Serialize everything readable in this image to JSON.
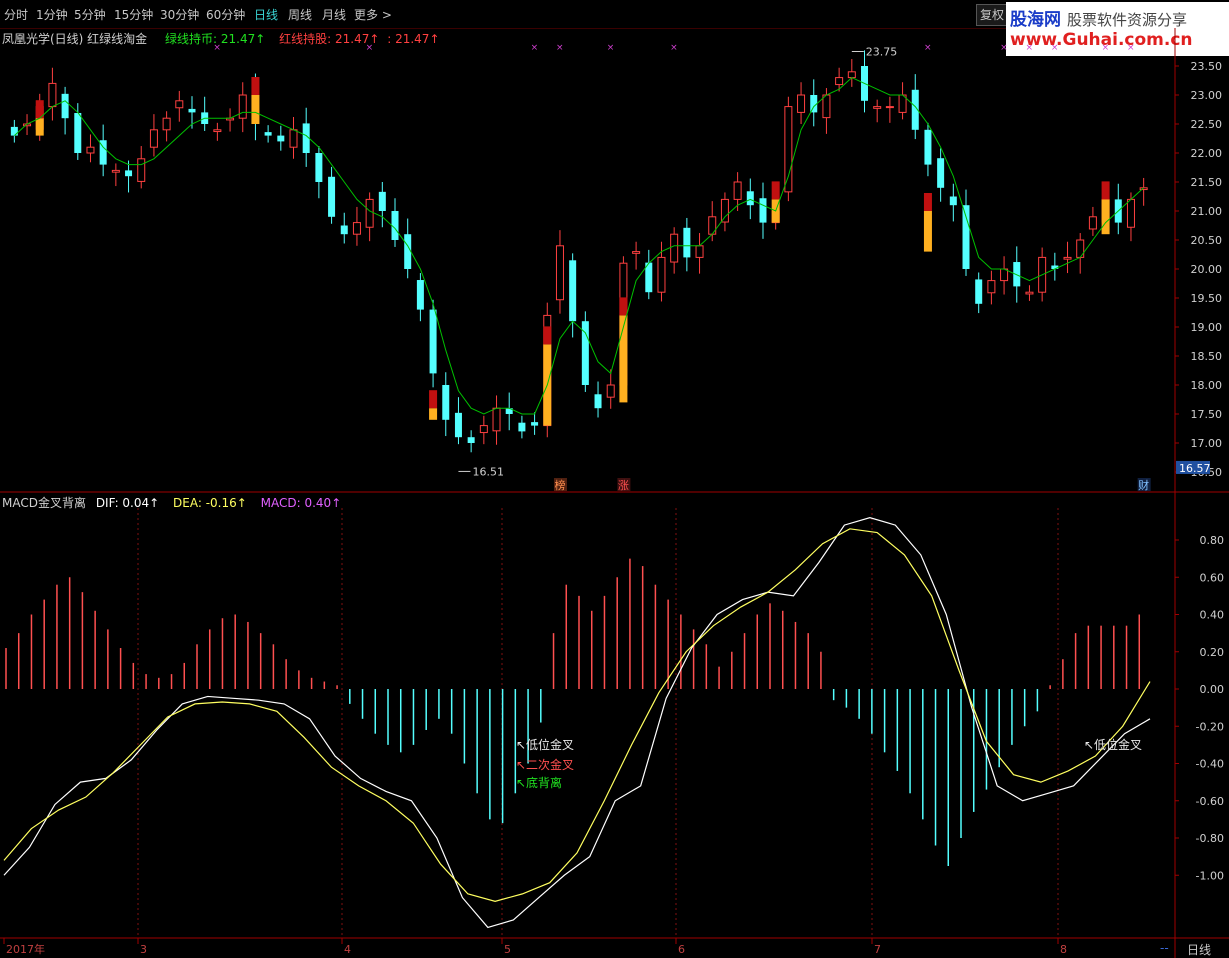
{
  "toolbar": {
    "periods": [
      "分时",
      "1分钟",
      "5分钟",
      "15分钟",
      "30分钟",
      "60分钟",
      "日线",
      "周线",
      "月线",
      "更多 >"
    ],
    "active": "日线",
    "fuquan": "复权"
  },
  "logo": {
    "line1": "股海网",
    "line1b": "股票软件资源分享",
    "line2": "www.Guhai.com.cn"
  },
  "main_panel": {
    "title": "凤凰光学(日线) 红绿线淘金",
    "green_label": "绿线持币: 21.47↑",
    "red_label": "红线持股: 21.47↑",
    "red_extra": ": 21.47↑",
    "high_label": "23.75",
    "low_label": "16.51",
    "last_price": "16.57",
    "markers": [
      "榜",
      "涨",
      "财"
    ]
  },
  "macd_panel": {
    "title": "MACD金叉背离",
    "dif": "DIF: 0.04↑",
    "dea": "DEA: -0.16↑",
    "macd": "MACD: 0.40↑",
    "annotations": [
      "↖低位金叉",
      "↖二次金叉",
      "↖底背离",
      "↖低位金叉"
    ]
  },
  "axis": {
    "dates": [
      "2017年",
      "3",
      "4",
      "5",
      "6",
      "7",
      "8"
    ],
    "footer_label": "日线",
    "footer_dash": "--"
  },
  "colors": {
    "up": "#ff4040",
    "down": "#54ffff",
    "green_line": "#00c000",
    "dif": "#ffffff",
    "dea": "#ffff60",
    "hist_up": "#ff5050",
    "hist_down": "#54ffff"
  },
  "chart_data": [
    {
      "type": "candlestick",
      "title": "凤凰光学(日线)",
      "ylim": [
        16.5,
        23.5
      ],
      "yticks": [
        16.5,
        17.0,
        17.5,
        18.0,
        18.5,
        19.0,
        19.5,
        20.0,
        20.5,
        21.0,
        21.5,
        22.0,
        22.5,
        23.0,
        23.5
      ],
      "close": [
        22.3,
        22.5,
        22.8,
        23.2,
        22.6,
        22.0,
        22.1,
        21.8,
        21.7,
        21.6,
        21.9,
        22.4,
        22.6,
        22.9,
        22.7,
        22.5,
        22.4,
        22.6,
        23.0,
        22.5,
        22.3,
        22.2,
        22.4,
        22.0,
        21.5,
        20.9,
        20.6,
        20.8,
        21.2,
        21.0,
        20.5,
        20.0,
        19.3,
        18.2,
        17.4,
        17.1,
        17.0,
        17.3,
        17.6,
        17.5,
        17.2,
        17.3,
        19.2,
        20.4,
        19.1,
        18.0,
        17.6,
        18.0,
        20.1,
        20.3,
        19.6,
        20.2,
        20.6,
        20.2,
        20.4,
        20.9,
        21.2,
        21.5,
        21.1,
        20.8,
        21.0,
        22.8,
        23.0,
        22.7,
        23.0,
        23.3,
        23.4,
        22.9,
        22.8,
        22.8,
        23.0,
        22.4,
        21.8,
        21.4,
        21.1,
        20.0,
        19.4,
        19.8,
        20.0,
        19.7,
        19.6,
        20.2,
        20.0,
        20.2,
        20.5,
        20.9,
        21.2,
        20.8,
        21.2,
        21.4
      ],
      "ma_line": [
        22.3,
        22.5,
        22.6,
        22.8,
        22.9,
        22.7,
        22.4,
        22.1,
        21.9,
        21.8,
        21.8,
        21.9,
        22.1,
        22.3,
        22.5,
        22.6,
        22.6,
        22.6,
        22.7,
        22.7,
        22.6,
        22.5,
        22.4,
        22.3,
        22.1,
        21.8,
        21.5,
        21.2,
        21.0,
        20.9,
        20.7,
        20.4,
        20.0,
        19.4,
        18.6,
        17.9,
        17.6,
        17.5,
        17.6,
        17.6,
        17.5,
        17.5,
        18.0,
        18.8,
        19.1,
        18.9,
        18.4,
        18.2,
        19.0,
        19.8,
        20.1,
        20.3,
        20.4,
        20.4,
        20.4,
        20.6,
        20.9,
        21.1,
        21.2,
        21.1,
        21.0,
        21.6,
        22.4,
        22.8,
        23.0,
        23.1,
        23.3,
        23.2,
        23.1,
        23.0,
        23.0,
        22.8,
        22.5,
        22.1,
        21.6,
        20.9,
        20.2,
        20.0,
        20.0,
        19.9,
        19.8,
        19.9,
        20.0,
        20.1,
        20.2,
        20.5,
        20.8,
        21.0,
        21.2,
        21.4
      ]
    },
    {
      "type": "bar",
      "title": "MACD金叉背离",
      "ylim": [
        -1.1,
        1.0
      ],
      "yticks": [
        0.8,
        0.6,
        0.4,
        0.2,
        -0.0,
        -0.2,
        -0.4,
        -0.6,
        -0.8,
        -1.0
      ],
      "histogram": [
        0.22,
        0.3,
        0.4,
        0.48,
        0.56,
        0.6,
        0.52,
        0.42,
        0.32,
        0.22,
        0.14,
        0.08,
        0.06,
        0.08,
        0.14,
        0.24,
        0.32,
        0.38,
        0.4,
        0.36,
        0.3,
        0.24,
        0.16,
        0.1,
        0.06,
        0.04,
        0.02,
        -0.08,
        -0.16,
        -0.24,
        -0.3,
        -0.34,
        -0.3,
        -0.22,
        -0.16,
        -0.24,
        -0.4,
        -0.56,
        -0.7,
        -0.72,
        -0.56,
        -0.4,
        -0.18,
        0.3,
        0.56,
        0.5,
        0.42,
        0.5,
        0.6,
        0.7,
        0.66,
        0.56,
        0.48,
        0.4,
        0.32,
        0.24,
        0.12,
        0.2,
        0.3,
        0.4,
        0.46,
        0.42,
        0.36,
        0.3,
        0.2,
        -0.06,
        -0.1,
        -0.16,
        -0.24,
        -0.34,
        -0.44,
        -0.56,
        -0.7,
        -0.84,
        -0.95,
        -0.8,
        -0.66,
        -0.54,
        -0.42,
        -0.3,
        -0.2,
        -0.12,
        0.02,
        0.16,
        0.3,
        0.34,
        0.34,
        0.34,
        0.34,
        0.4
      ],
      "dif": [
        -1.0,
        -0.85,
        -0.62,
        -0.5,
        -0.48,
        -0.38,
        -0.22,
        -0.08,
        -0.04,
        -0.05,
        -0.06,
        -0.08,
        -0.16,
        -0.36,
        -0.48,
        -0.55,
        -0.6,
        -0.8,
        -1.12,
        -1.28,
        -1.24,
        -1.12,
        -1.0,
        -0.9,
        -0.6,
        -0.52,
        -0.05,
        0.22,
        0.4,
        0.48,
        0.52,
        0.5,
        0.68,
        0.88,
        0.92,
        0.88,
        0.72,
        0.4,
        -0.1,
        -0.52,
        -0.6,
        -0.56,
        -0.52,
        -0.38,
        -0.24,
        -0.16
      ],
      "dea": [
        -0.92,
        -0.75,
        -0.65,
        -0.58,
        -0.45,
        -0.3,
        -0.15,
        -0.08,
        -0.07,
        -0.08,
        -0.12,
        -0.26,
        -0.42,
        -0.52,
        -0.6,
        -0.72,
        -0.94,
        -1.1,
        -1.14,
        -1.1,
        -1.04,
        -0.88,
        -0.6,
        -0.3,
        -0.02,
        0.2,
        0.34,
        0.44,
        0.52,
        0.64,
        0.78,
        0.86,
        0.84,
        0.72,
        0.5,
        0.1,
        -0.28,
        -0.46,
        -0.5,
        -0.44,
        -0.36,
        -0.2,
        0.04
      ]
    }
  ]
}
